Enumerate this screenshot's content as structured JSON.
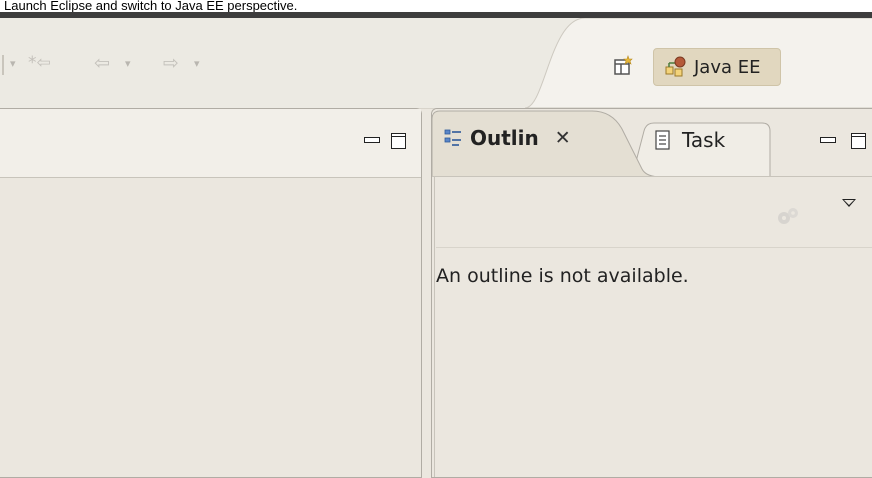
{
  "caption": "Launch Eclipse and switch to Java EE perspective.",
  "toolbar": {
    "icons": [
      "dropdown-arrow-icon",
      "last-edit-location-icon",
      "back-arrow-icon",
      "dropdown-arrow-icon",
      "forward-arrow-icon",
      "dropdown-arrow-icon"
    ],
    "nav_glyphs": {
      "drop": "▾",
      "last_edit": "*⇦",
      "back": "⇦",
      "forward": "⇨"
    }
  },
  "perspective": {
    "open_icon": "open-perspective-icon",
    "active_label": "Java EE",
    "active_icon": "java-ee-perspective-icon",
    "accent": "#e1d7bf"
  },
  "left_panel": {
    "controls": [
      "minimize-icon",
      "maximize-icon"
    ]
  },
  "right_panel": {
    "tabs": [
      {
        "label": "Outlin",
        "icon": "outline-icon",
        "active": true,
        "close_glyph": "✕"
      },
      {
        "label": "Task",
        "icon": "task-list-icon",
        "active": false
      }
    ],
    "controls": [
      "minimize-icon",
      "maximize-icon"
    ],
    "view_menu_icon": "view-menu-chevron-icon",
    "disabled_icon": "gears-icon",
    "message": "An outline is not available."
  },
  "colors": {
    "background": "#ebe7df",
    "toolbar": "#eceae3",
    "border": "#b0aca4",
    "dark_bar": "#3d3d3d"
  }
}
